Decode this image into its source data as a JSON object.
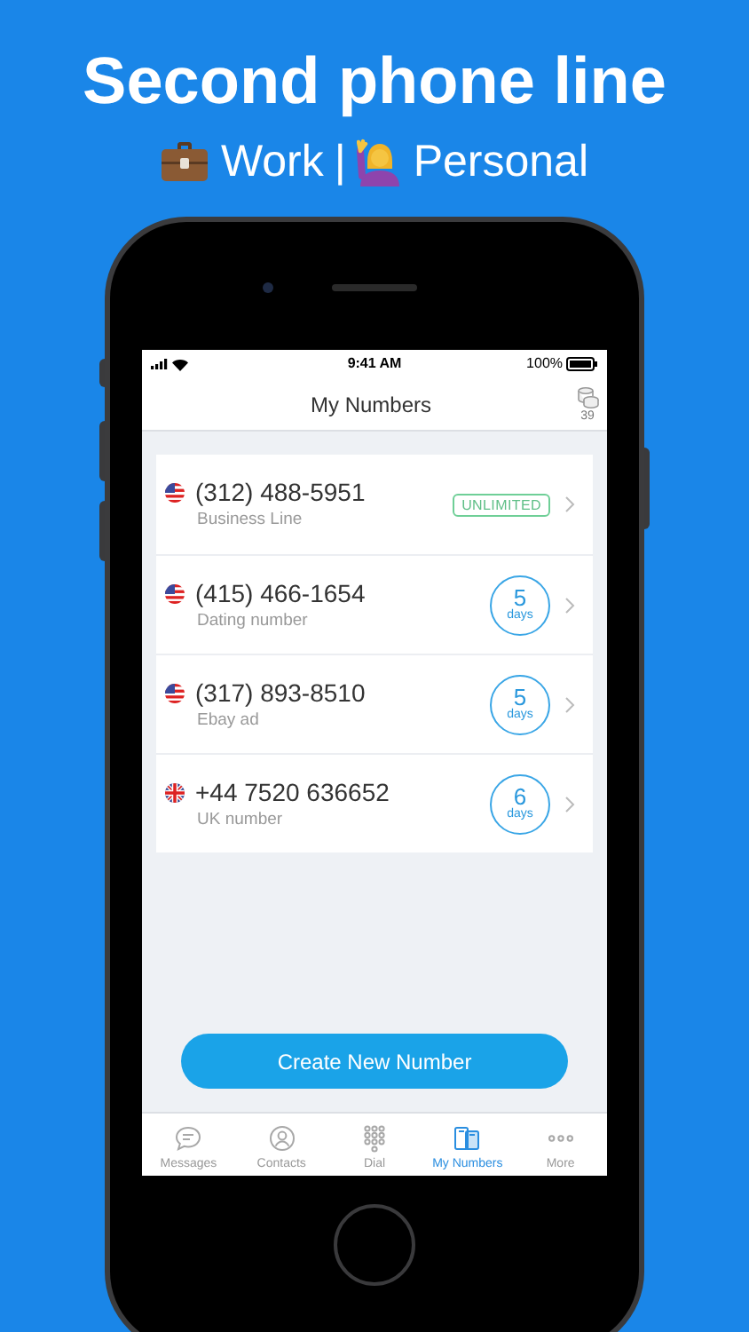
{
  "headline": {
    "title": "Second phone line",
    "subtitle_parts": [
      "Work",
      "|",
      "Personal"
    ]
  },
  "status_bar": {
    "time": "9:41 AM",
    "battery": "100%"
  },
  "nav": {
    "title": "My Numbers",
    "credits": "39"
  },
  "numbers": [
    {
      "flag": {
        "kind": "us"
      },
      "number": "(312) 488-5951",
      "label": "Business Line",
      "kind": "unlimited",
      "badge": "UNLIMITED"
    },
    {
      "flag": {
        "kind": "us"
      },
      "number": "(415) 466-1654",
      "label": "Dating number",
      "kind": "days",
      "count": "5",
      "unit": "days"
    },
    {
      "flag": {
        "kind": "us"
      },
      "number": "(317) 893-8510",
      "label": "Ebay ad",
      "kind": "days",
      "count": "5",
      "unit": "days"
    },
    {
      "flag": {
        "kind": "uk"
      },
      "number": "+44 7520 636652",
      "label": "UK number",
      "kind": "days",
      "count": "6",
      "unit": "days"
    }
  ],
  "create_button": "Create New Number",
  "tabs": [
    {
      "label": "Messages",
      "kind": "messages",
      "selected": false
    },
    {
      "label": "Contacts",
      "kind": "contacts",
      "selected": false
    },
    {
      "label": "Dial",
      "kind": "dial",
      "selected": false
    },
    {
      "label": "My Numbers",
      "kind": "numbers",
      "selected": true
    },
    {
      "label": "More",
      "kind": "more",
      "selected": false
    }
  ]
}
